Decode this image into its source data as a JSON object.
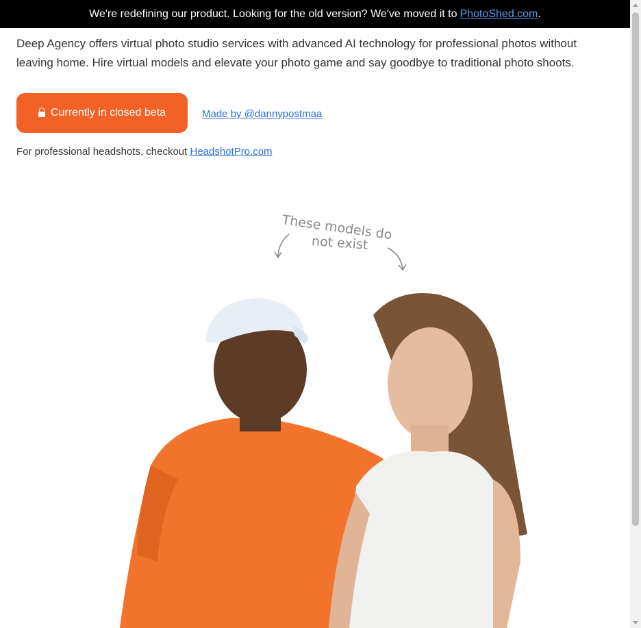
{
  "banner": {
    "text": "We're redefining our product. Looking for the old version? We've moved it to",
    "link": "PhotoShed.com",
    "suffix": "."
  },
  "intro": "Deep Agency offers virtual photo studio services with advanced AI technology for professional photos without leaving home. Hire virtual models and elevate your photo game and say goodbye to traditional photo shoots.",
  "beta_button": {
    "label": "Currently in closed beta",
    "icon": "lock-icon",
    "color": "#f26125"
  },
  "made_by": "Made by @dannypostmaa",
  "headshots": {
    "text": "For professional headshots, checkout",
    "link": "HeadshotPro.com"
  },
  "note": {
    "line1": "These models do",
    "line2": "not exist"
  }
}
